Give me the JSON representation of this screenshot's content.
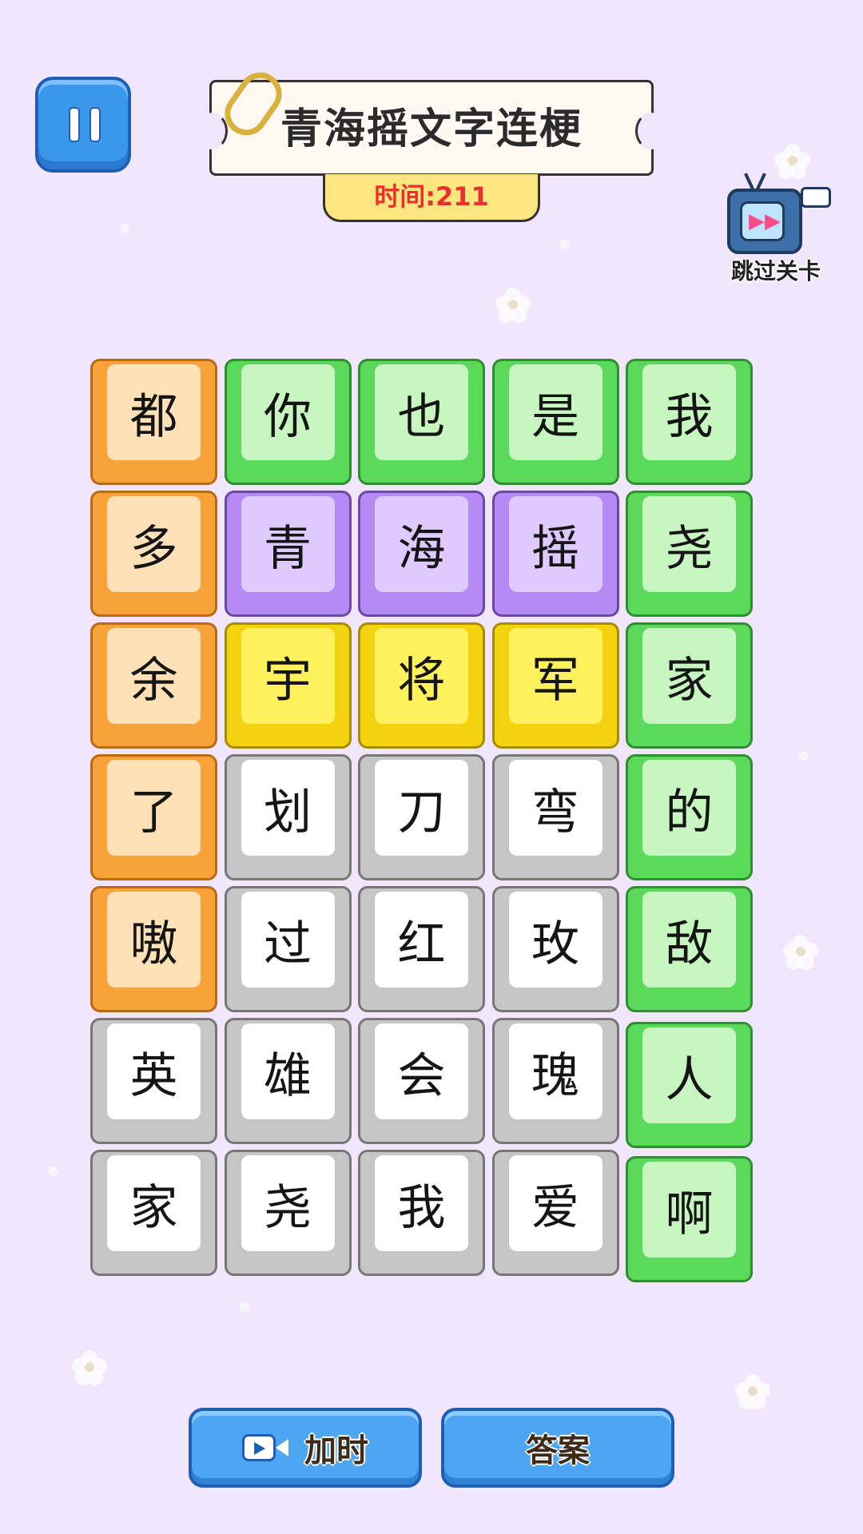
{
  "header": {
    "title": "青海摇文字连梗",
    "timer_label": "时间:",
    "timer_value": "211"
  },
  "skip": {
    "label": "跳过关卡"
  },
  "buttons": {
    "add_time_label": "加时",
    "answer_label": "答案"
  },
  "colors": {
    "background": "#f1e6fb",
    "orange": "#f7a33a",
    "green": "#5ad95b",
    "purple": "#b58af5",
    "yellow": "#f3d20f",
    "gray": "#c6c6c6",
    "button_blue": "#4ca6f2",
    "timer_red": "#e8302e"
  },
  "grid": {
    "tiles": [
      {
        "char": "都",
        "color": "orange"
      },
      {
        "char": "你",
        "color": "green"
      },
      {
        "char": "也",
        "color": "green"
      },
      {
        "char": "是",
        "color": "green"
      },
      {
        "char": "我",
        "color": "green"
      },
      {
        "char": "多",
        "color": "orange"
      },
      {
        "char": "青",
        "color": "purple"
      },
      {
        "char": "海",
        "color": "purple"
      },
      {
        "char": "摇",
        "color": "purple"
      },
      {
        "char": "尧",
        "color": "green"
      },
      {
        "char": "余",
        "color": "orange"
      },
      {
        "char": "宇",
        "color": "yellow"
      },
      {
        "char": "将",
        "color": "yellow"
      },
      {
        "char": "军",
        "color": "yellow"
      },
      {
        "char": "家",
        "color": "green"
      },
      {
        "char": "了",
        "color": "orange"
      },
      {
        "char": "划",
        "color": "gray"
      },
      {
        "char": "刀",
        "color": "gray"
      },
      {
        "char": "弯",
        "color": "gray"
      },
      {
        "char": "的",
        "color": "green"
      },
      {
        "char": "嗷",
        "color": "orange"
      },
      {
        "char": "过",
        "color": "gray"
      },
      {
        "char": "红",
        "color": "gray"
      },
      {
        "char": "玫",
        "color": "gray"
      },
      {
        "char": "敌",
        "color": "green"
      },
      {
        "char": "英",
        "color": "gray"
      },
      {
        "char": "雄",
        "color": "gray"
      },
      {
        "char": "会",
        "color": "gray"
      },
      {
        "char": "瑰",
        "color": "gray"
      },
      {
        "char": "人",
        "color": "green"
      },
      {
        "char": "家",
        "color": "gray"
      },
      {
        "char": "尧",
        "color": "gray"
      },
      {
        "char": "我",
        "color": "gray"
      },
      {
        "char": "爱",
        "color": "gray"
      },
      {
        "char": "啊",
        "color": "green"
      }
    ]
  }
}
